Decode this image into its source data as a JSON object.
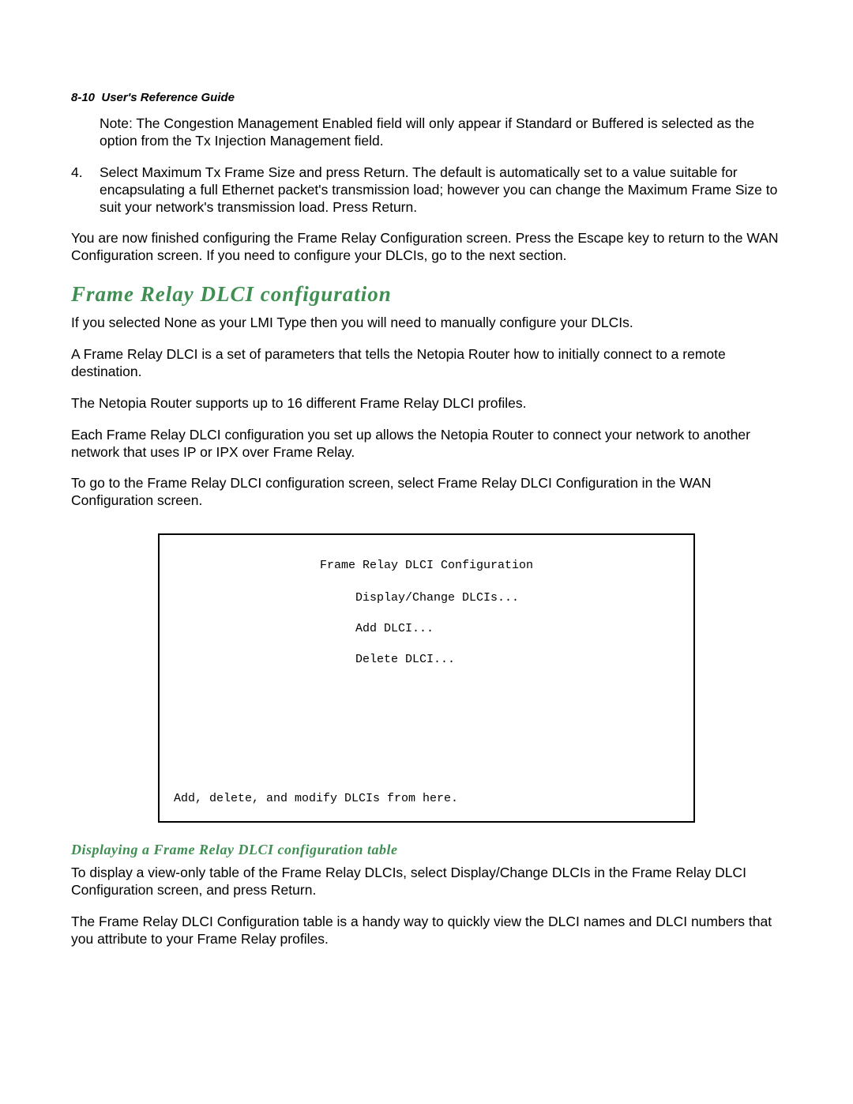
{
  "header": {
    "page_number": "8-10",
    "title": "User's Reference Guide"
  },
  "content": {
    "note": "Note: The Congestion Management Enabled field will only appear if Standard or Buffered is selected as the option from the Tx Injection Management field.",
    "step4_number": "4.",
    "step4_text": "Select Maximum Tx Frame Size and press Return. The default is automatically set to a value suitable for encapsulating a full Ethernet packet's transmission load; however you can change the Maximum Frame Size to suit your network's transmission load. Press Return.",
    "finished": "You are now finished configuring the Frame Relay Configuration screen. Press the Escape key to return to the WAN Configuration screen. If you need to configure your DLCIs, go to the next section.",
    "section_title": "Frame Relay DLCI configuration",
    "p1": "If you selected None as your LMI Type then you will need to manually configure your DLCIs.",
    "p2": "A Frame Relay DLCI is a set of parameters that tells the Netopia Router how to initially connect to a remote destination.",
    "p3": "The Netopia Router supports up to 16 different Frame Relay DLCI profiles.",
    "p4": "Each Frame Relay DLCI configuration you set up allows the Netopia Router to connect your network to another network that uses IP or IPX over Frame Relay.",
    "p5": "To go to the Frame Relay DLCI configuration screen, select Frame Relay DLCI Configuration in the WAN Configuration screen.",
    "terminal": {
      "title": "Frame Relay DLCI Configuration",
      "menu": [
        "Display/Change DLCIs...",
        "Add DLCI...",
        "Delete DLCI..."
      ],
      "footer": "Add, delete, and modify DLCIs from here."
    },
    "sub_title": "Displaying a Frame Relay DLCI configuration table",
    "p6": "To display a view-only table of the Frame Relay DLCIs, select Display/Change DLCIs in the Frame Relay DLCI Configuration screen, and press Return.",
    "p7": "The Frame Relay DLCI Configuration table is a handy way to quickly view the DLCI names and DLCI numbers that you attribute to your Frame Relay profiles."
  }
}
